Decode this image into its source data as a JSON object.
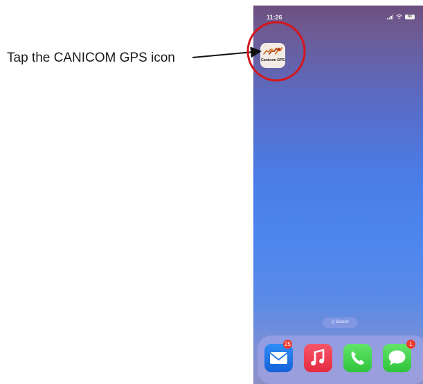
{
  "instruction": {
    "text": "Tap the CANICOM GPS icon"
  },
  "phone": {
    "status_bar": {
      "time": "11:26",
      "battery_label": "83"
    },
    "app_icon": {
      "name": "CANICOM GPS",
      "logo_text": "Canicom GPS",
      "highlight_color": "#d4161c"
    },
    "search_label": "Q Search",
    "dock": {
      "apps": [
        {
          "name": "mail-icon",
          "badge": "25"
        },
        {
          "name": "music-icon",
          "badge": ""
        },
        {
          "name": "phone-icon",
          "badge": ""
        },
        {
          "name": "messages-icon",
          "badge": "1"
        }
      ]
    }
  },
  "colors": {
    "highlight_circle": "#d4161c",
    "arrow": "#111111"
  }
}
